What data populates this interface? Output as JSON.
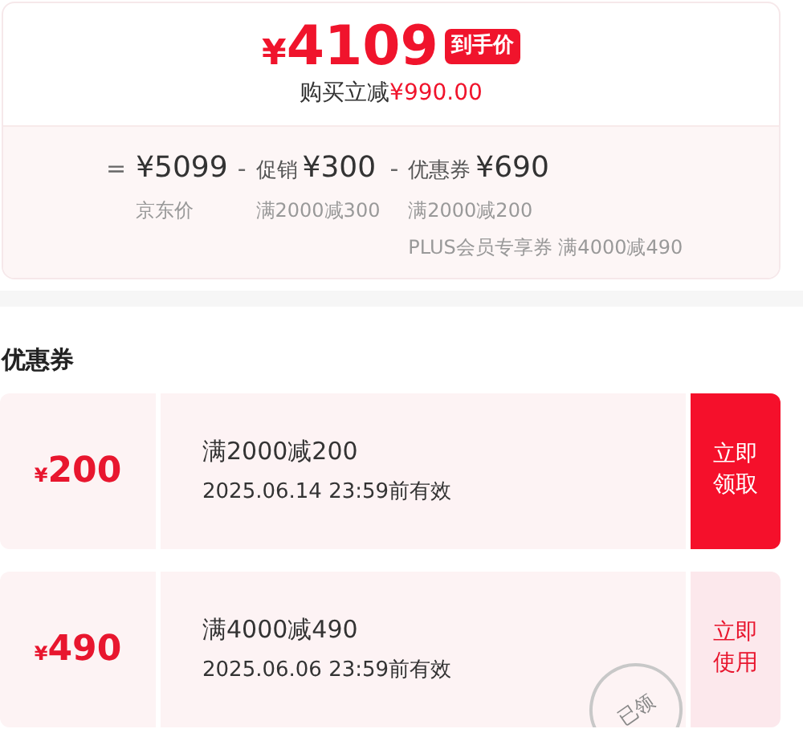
{
  "summary": {
    "currency": "¥",
    "price": "4109",
    "price_tag": "到手价",
    "saving_label": "购买立减",
    "saving_amount": "¥990.00",
    "breakdown": [
      {
        "operator": "=",
        "amount": "¥5099",
        "notes": [
          "京东价"
        ]
      },
      {
        "operator": "-",
        "label": "促销",
        "amount": "¥300",
        "notes": [
          "满2000减300"
        ]
      },
      {
        "operator": "-",
        "label": "优惠券",
        "amount": "¥690",
        "notes": [
          "满2000减200",
          "PLUS会员专享券 满4000减490"
        ]
      }
    ]
  },
  "coupons_section": {
    "title": "优惠券",
    "coupons": [
      {
        "currency": "¥",
        "value": "200",
        "condition": "满2000减200",
        "validity": "2025.06.14 23:59前有效",
        "action": [
          "立即",
          "领取"
        ],
        "claimed": false
      },
      {
        "currency": "¥",
        "value": "490",
        "condition": "满4000减490",
        "validity": "2025.06.06 23:59前有效",
        "action": [
          "立即",
          "使用"
        ],
        "claimed": true,
        "stamp": "已领"
      }
    ]
  }
}
